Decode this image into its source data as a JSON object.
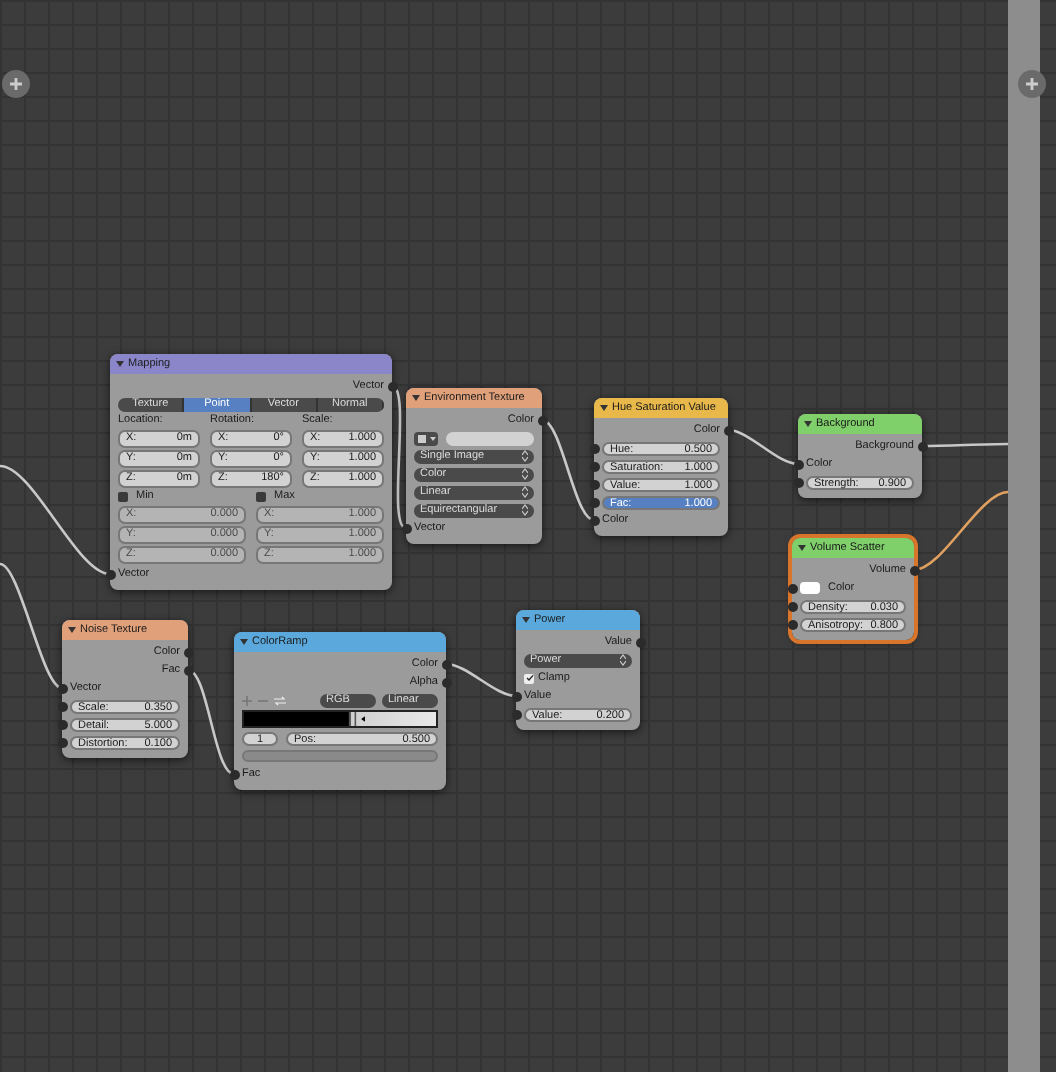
{
  "nodes": [
    {
      "title": "Mapping",
      "color": "#8a86c9",
      "selected": false,
      "rows": [
        {
          "kind": "output",
          "label": "Vector"
        },
        {
          "kind": "tabs",
          "items": [
            {
              "label": "Texture",
              "selected": false
            },
            {
              "label": "Point",
              "selected": true
            },
            {
              "label": "Vector",
              "selected": false
            },
            {
              "label": "Normal",
              "selected": false
            }
          ]
        },
        {
          "kind": "columns",
          "columns": [
            {
              "label": "Location:",
              "fields": [
                {
                  "label": "X:",
                  "value": "0m"
                },
                {
                  "label": "Y:",
                  "value": "0m"
                },
                {
                  "label": "Z:",
                  "value": "0m"
                }
              ]
            },
            {
              "label": "Rotation:",
              "fields": [
                {
                  "label": "X:",
                  "value": "0°"
                },
                {
                  "label": "Y:",
                  "value": "0°"
                },
                {
                  "label": "Z:",
                  "value": "180°"
                }
              ]
            },
            {
              "label": "Scale:",
              "fields": [
                {
                  "label": "X:",
                  "value": "1.000"
                },
                {
                  "label": "Y:",
                  "value": "1.000"
                },
                {
                  "label": "Z:",
                  "value": "1.000"
                }
              ]
            }
          ]
        },
        {
          "kind": "columns",
          "columns": [
            {
              "label": "Min",
              "checked": false,
              "fields": [
                {
                  "label": "X:",
                  "value": "0.000"
                },
                {
                  "label": "Y:",
                  "value": "0.000"
                },
                {
                  "label": "Z:",
                  "value": "0.000"
                }
              ]
            },
            {
              "label": "Max",
              "checked": false,
              "fields": [
                {
                  "label": "X:",
                  "value": "1.000"
                },
                {
                  "label": "Y:",
                  "value": "1.000"
                },
                {
                  "label": "Z:",
                  "value": "1.000"
                }
              ]
            }
          ]
        },
        {
          "kind": "input",
          "label": "Vector"
        }
      ]
    },
    {
      "title": "Environment Texture",
      "color": "#e0a07a",
      "selected": false,
      "rows": [
        {
          "kind": "output",
          "label": "Color"
        },
        {
          "kind": "image_selector"
        },
        {
          "kind": "dropdown",
          "value": "Single Image"
        },
        {
          "kind": "dropdown",
          "value": "Color"
        },
        {
          "kind": "dropdown",
          "value": "Linear"
        },
        {
          "kind": "dropdown",
          "value": "Equirectangular"
        },
        {
          "kind": "input",
          "label": "Vector"
        }
      ]
    },
    {
      "title": "Hue Saturation Value",
      "color": "#e8b84a",
      "selected": false,
      "rows": [
        {
          "kind": "output",
          "label": "Color"
        },
        {
          "kind": "field",
          "label": "Hue:",
          "value": "0.500",
          "selected": false
        },
        {
          "kind": "field",
          "label": "Saturation:",
          "value": "1.000",
          "selected": false
        },
        {
          "kind": "field",
          "label": "Value:",
          "value": "1.000",
          "selected": false
        },
        {
          "kind": "field",
          "label": "Fac:",
          "value": "1.000",
          "selected": true
        },
        {
          "kind": "input",
          "label": "Color"
        }
      ]
    },
    {
      "title": "Background",
      "color": "#7fcf6a",
      "selected": false,
      "rows": [
        {
          "kind": "output",
          "label": "Background"
        },
        {
          "kind": "input",
          "label": "Color"
        },
        {
          "kind": "field",
          "label": "Strength:",
          "value": "0.900"
        }
      ]
    },
    {
      "title": "Volume Scatter",
      "color": "#7fcf6a",
      "selected": true,
      "rows": [
        {
          "kind": "output",
          "label": "Volume"
        },
        {
          "kind": "color_input",
          "label": "Color"
        },
        {
          "kind": "field",
          "label": "Density:",
          "value": "0.030"
        },
        {
          "kind": "field",
          "label": "Anisotropy:",
          "value": "0.800"
        }
      ]
    },
    {
      "title": "Noise Texture",
      "color": "#e0a07a",
      "selected": false,
      "rows": [
        {
          "kind": "output",
          "label": "Color"
        },
        {
          "kind": "output",
          "label": "Fac"
        },
        {
          "kind": "input",
          "label": "Vector"
        },
        {
          "kind": "field",
          "label": "Scale:",
          "value": "0.350"
        },
        {
          "kind": "field",
          "label": "Detail:",
          "value": "5.000"
        },
        {
          "kind": "field",
          "label": "Distortion:",
          "value": "0.100"
        }
      ]
    },
    {
      "title": "ColorRamp",
      "color": "#5aa8dc",
      "selected": false,
      "rows": [
        {
          "kind": "output",
          "label": "Color"
        },
        {
          "kind": "output",
          "label": "Alpha"
        },
        {
          "kind": "ramp_toolbar",
          "mode": "RGB",
          "interpolation": "Linear"
        },
        {
          "kind": "ramp"
        },
        {
          "kind": "ramp_stop",
          "index": "1",
          "label": "Pos:",
          "value": "0.500"
        },
        {
          "kind": "swatch"
        },
        {
          "kind": "input",
          "label": "Fac"
        }
      ]
    },
    {
      "title": "Power",
      "color": "#5aa8dc",
      "selected": false,
      "rows": [
        {
          "kind": "output",
          "label": "Value"
        },
        {
          "kind": "dropdown",
          "value": "Power"
        },
        {
          "kind": "checkbox",
          "label": "Clamp",
          "checked": true
        },
        {
          "kind": "input",
          "label": "Value"
        },
        {
          "kind": "field",
          "label": "Value:",
          "value": "0.200"
        }
      ]
    }
  ]
}
